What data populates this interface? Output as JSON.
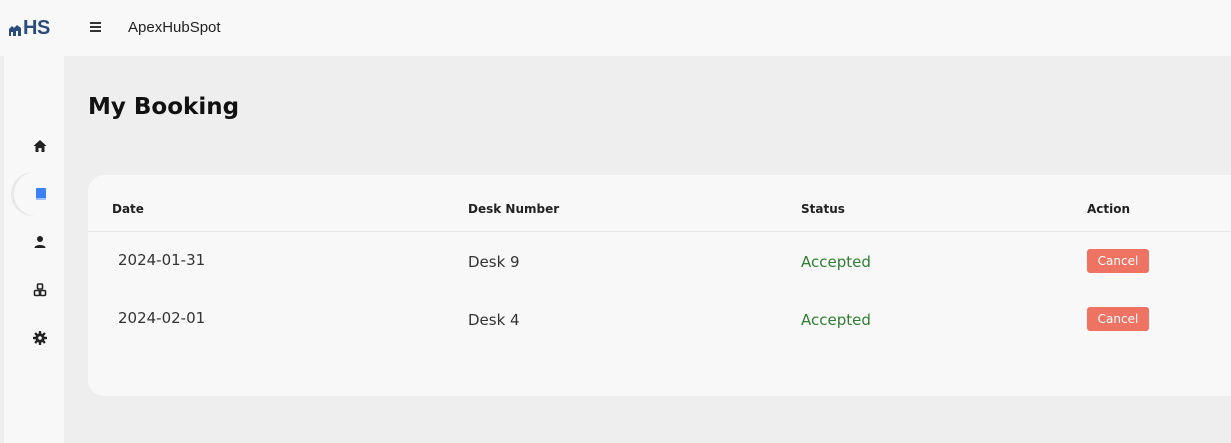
{
  "header": {
    "logo_text": "HS",
    "app_title": "ApexHubSpot",
    "menu_icon": "hamburger-menu-icon"
  },
  "sidebar": {
    "items": [
      {
        "icon": "home-icon",
        "active": false
      },
      {
        "icon": "book-icon",
        "active": true
      },
      {
        "icon": "person-icon",
        "active": false
      },
      {
        "icon": "grid-icon",
        "active": false
      },
      {
        "icon": "gear-icon",
        "active": false
      }
    ],
    "active_color": "#3b82f6"
  },
  "page": {
    "title": "My Booking"
  },
  "table": {
    "headers": [
      "Date",
      "Desk Number",
      "Status",
      "Action"
    ],
    "rows": [
      {
        "date": "2024-01-31",
        "desk": "Desk 9",
        "status": "Accepted",
        "action": "Cancel"
      },
      {
        "date": "2024-02-01",
        "desk": "Desk 4",
        "status": "Accepted",
        "action": "Cancel"
      }
    ]
  },
  "colors": {
    "status_accepted": "#2e7d32",
    "cancel_button": "#ee7363",
    "logo": "#2b4c7e"
  }
}
